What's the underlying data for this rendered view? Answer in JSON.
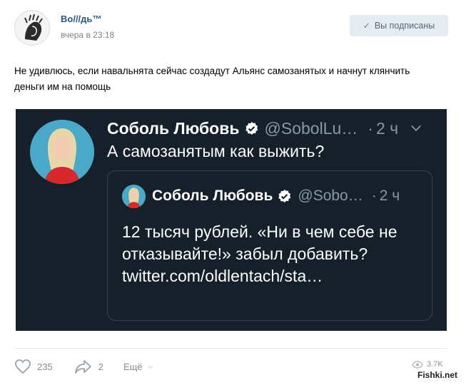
{
  "post": {
    "author": "Во///дь™",
    "time": "вчера в 23:18",
    "subscribe_label": "Вы подписаны",
    "text": "Не удивлюсь, если навальнята сейчас создадут Альянс самозанятых и начнут клянчить деньги им на помощь"
  },
  "tweet": {
    "name": "Соболь Любовь",
    "handle": "@SobolLu…",
    "dot": "·",
    "time": "2 ч",
    "text": "А самозанятым как выжить?",
    "quote": {
      "name": "Соболь Любовь",
      "handle": "@Sobo…",
      "dot": "·",
      "time": "2 ч",
      "text": "12 тысяч рублей. «Ни в чем себе не отказывайте!» забыл добавить? twitter.com/oldlentach/sta…"
    }
  },
  "actions": {
    "likes": "235",
    "shares": "2",
    "more_label": "Ещё",
    "more_chevron": "⌵",
    "views": "3.7K"
  },
  "watermark": "Fishki.net",
  "colors": {
    "link": "#2a5885",
    "tweet_bg": "#15202b",
    "verified": "#ffffff",
    "muted": "#8899a6"
  },
  "icons": [
    "check-icon",
    "verified-icon",
    "chevron-down-icon",
    "heart-icon",
    "share-icon",
    "eye-icon"
  ]
}
